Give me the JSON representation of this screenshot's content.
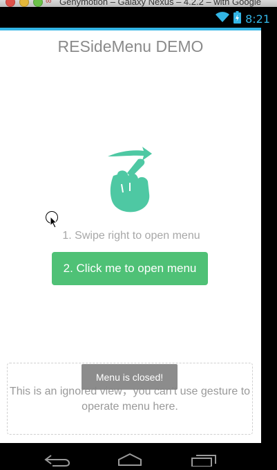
{
  "window": {
    "title": "Genymotion – Galaxy Nexus – 4.2.2 – with Google"
  },
  "status_bar": {
    "time": "8:21",
    "icons": [
      "wifi-icon",
      "battery-icon"
    ],
    "accent_color": "#33b5e5"
  },
  "app": {
    "title": "RESideMenu DEMO",
    "swipe_hint": "1. Swipe right to open menu",
    "open_button_label": "2. Click me to open menu",
    "ignored_view_text": "This is an ignored view，you can't use gesture to operate menu here.",
    "toast": "Menu is closed!",
    "hand_icon": "swipe-hand-icon",
    "button_color": "#4fc176",
    "icon_color": "#4ec8a3"
  },
  "nav_bar": {
    "buttons": [
      "back-icon",
      "home-icon",
      "recent-apps-icon"
    ]
  }
}
